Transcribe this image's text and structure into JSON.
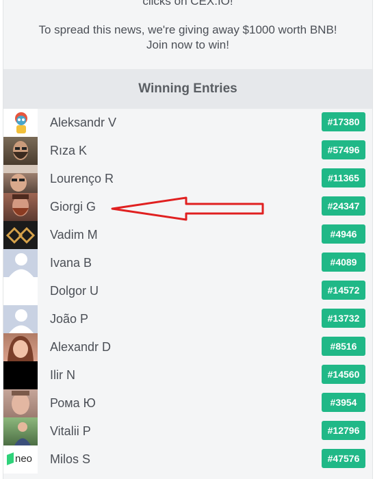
{
  "intro": {
    "line1": "clicks on CEX.IO!",
    "line2": "To spread this news, we're giving away $1000 worth BNB! Join now to win!"
  },
  "header": {
    "title": "Winning Entries"
  },
  "entries": [
    {
      "name": "Aleksandr V",
      "entry": "#17380",
      "avatar": "toy-figure-avatar"
    },
    {
      "name": "Rıza K",
      "entry": "#57496",
      "avatar": "bearded-man-avatar"
    },
    {
      "name": "Lourenço R",
      "entry": "#11365",
      "avatar": "selfie-avatar"
    },
    {
      "name": "Giorgi G",
      "entry": "#24347",
      "avatar": "red-beard-avatar"
    },
    {
      "name": "Vadim M",
      "entry": "#4946",
      "avatar": "gold-logo-avatar"
    },
    {
      "name": "Ivana B",
      "entry": "#4089",
      "avatar": "default-user-avatar"
    },
    {
      "name": "Dolgor U",
      "entry": "#14572",
      "avatar": "blank-avatar"
    },
    {
      "name": "João P",
      "entry": "#13732",
      "avatar": "default-user-avatar"
    },
    {
      "name": "Alexandr D",
      "entry": "#8516",
      "avatar": "woman-avatar"
    },
    {
      "name": "Ilir N",
      "entry": "#14560",
      "avatar": "black-avatar"
    },
    {
      "name": "Рома Ю",
      "entry": "#3954",
      "avatar": "face-avatar"
    },
    {
      "name": "Vitalii P",
      "entry": "#12796",
      "avatar": "outdoor-avatar"
    },
    {
      "name": "Milos S",
      "entry": "#47576",
      "avatar": "neo-logo-avatar",
      "logo_text": "neo"
    }
  ],
  "colors": {
    "badge": "#20b887",
    "arrow": "#e02020",
    "header_bg": "#e6e8eb"
  },
  "annotation": {
    "type": "arrow-left",
    "points_to": "Giorgi G"
  }
}
